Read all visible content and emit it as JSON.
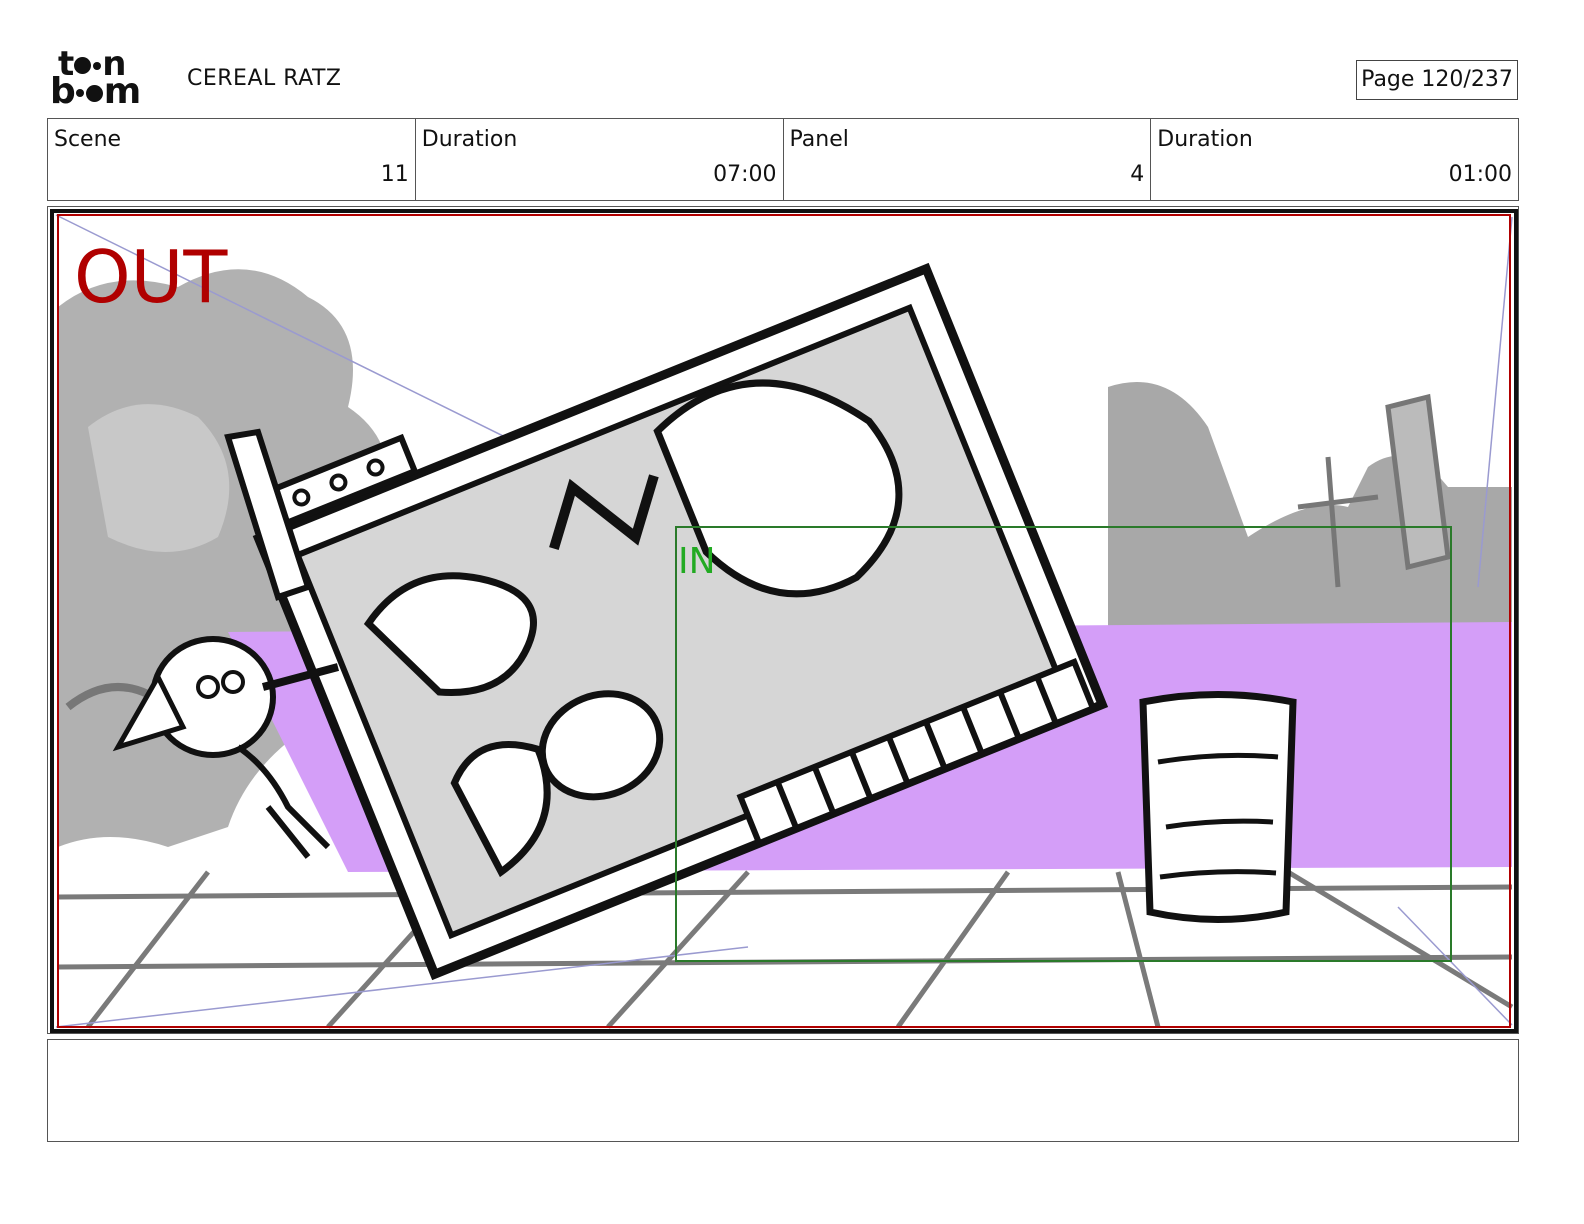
{
  "header": {
    "logo_line1": "toon",
    "logo_line2": "boom",
    "project_title": "CEREAL RATZ",
    "page_label": "Page 120/237"
  },
  "info": [
    {
      "label": "Scene",
      "value": "11"
    },
    {
      "label": "Duration",
      "value": "07:00"
    },
    {
      "label": "Panel",
      "value": "4"
    },
    {
      "label": "Duration",
      "value": "01:00"
    }
  ],
  "panel": {
    "out_label": "OUT",
    "in_label": "IN",
    "colors": {
      "out_frame": "#b00000",
      "in_frame": "#2a7a2a",
      "floor_band": "#d49ef8",
      "scenery_gray": "#9a9a9a"
    }
  },
  "notes": {
    "text": ""
  }
}
